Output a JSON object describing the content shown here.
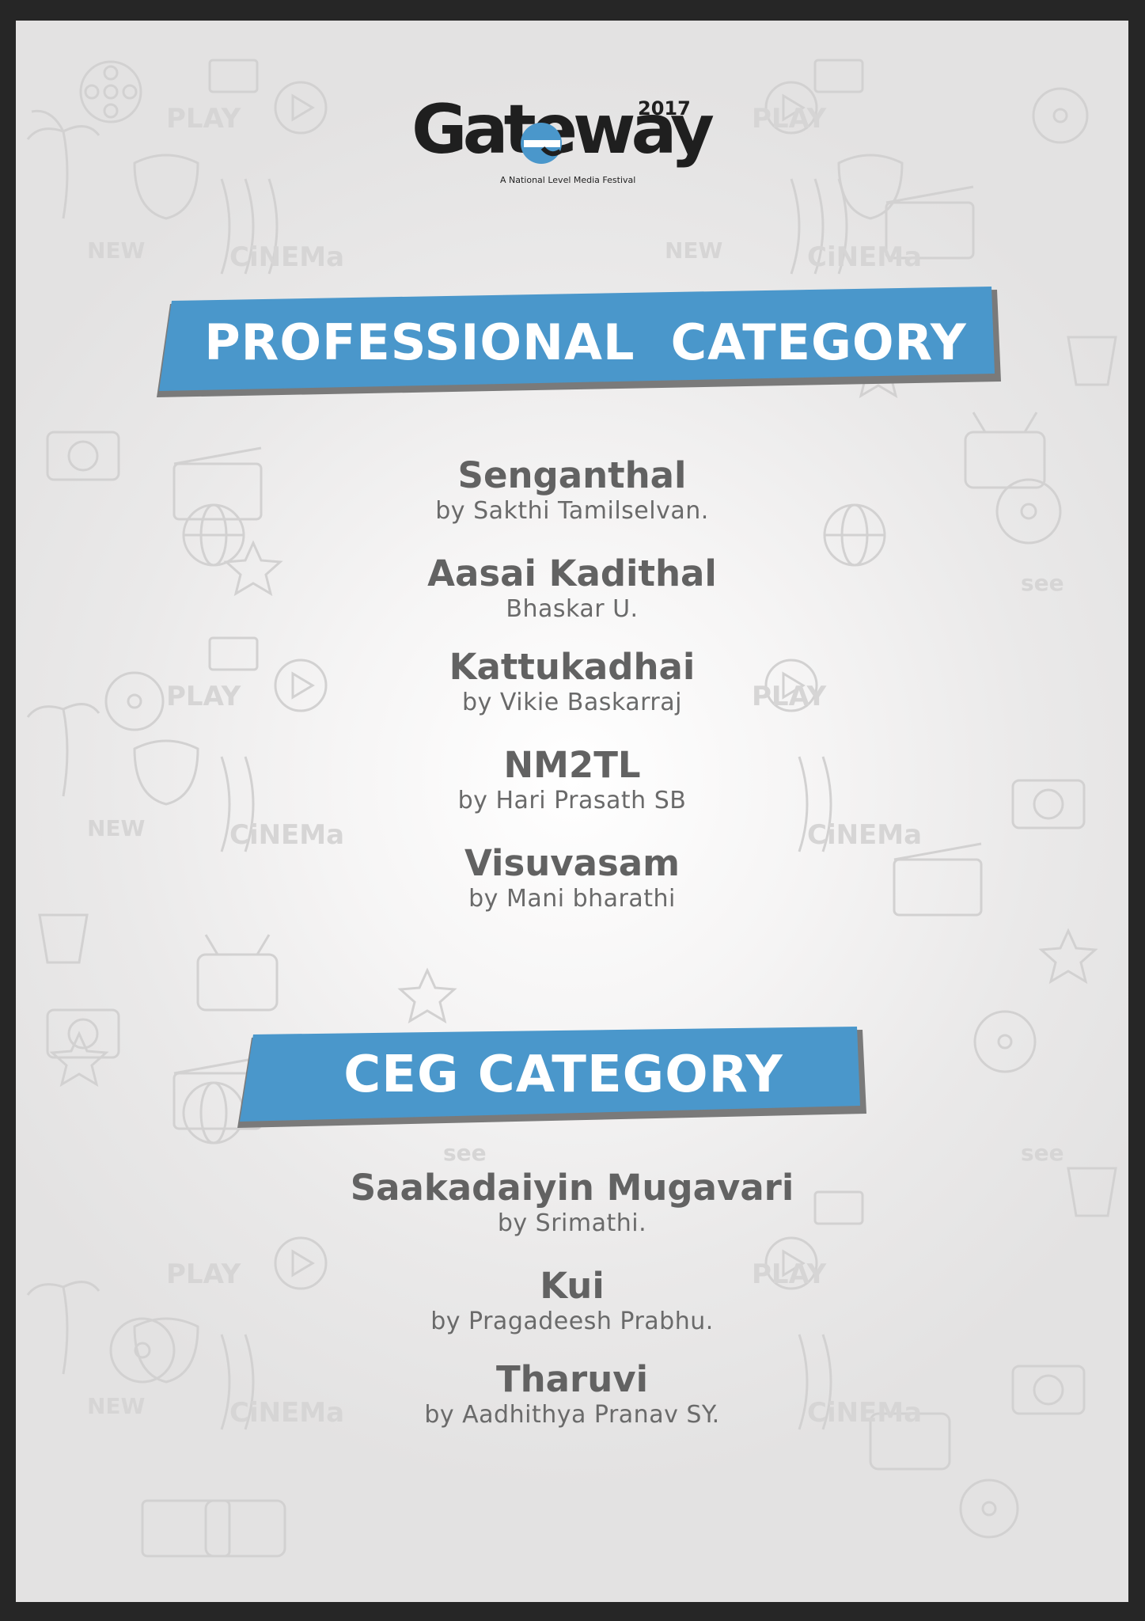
{
  "logo": {
    "wordmark": "Gateway",
    "year": "2017",
    "tagline": "A National Level Media Festival"
  },
  "background_icons": [
    "film-reel-icon",
    "play-icon",
    "popcorn-icon",
    "clapperboard-icon",
    "camera-icon",
    "tv-icon",
    "star-icon",
    "mask-icon",
    "palm-tree-icon",
    "dvd-icon",
    "globe-icon"
  ],
  "colors": {
    "banner": "#4a97cb",
    "banner_shadow": "#7a7a7a",
    "text": "#626262"
  },
  "sections": [
    {
      "title": "PROFESSIONAL  CATEGORY",
      "entries": [
        {
          "title": "Senganthal",
          "by": "by Sakthi Tamilselvan."
        },
        {
          "title": "Aasai Kadithal",
          "by": "Bhaskar U."
        },
        {
          "title": "Kattukadhai",
          "by": "by Vikie Baskarraj"
        },
        {
          "title": "NM2TL",
          "by": "by Hari Prasath SB"
        },
        {
          "title": "Visuvasam",
          "by": "by Mani bharathi"
        }
      ]
    },
    {
      "title": "CEG CATEGORY",
      "entries": [
        {
          "title": "Saakadaiyin Mugavari",
          "by": "by Srimathi."
        },
        {
          "title": "Kui",
          "by": "by Pragadeesh Prabhu."
        },
        {
          "title": "Tharuvi",
          "by": "by Aadhithya Pranav SY."
        }
      ]
    }
  ]
}
